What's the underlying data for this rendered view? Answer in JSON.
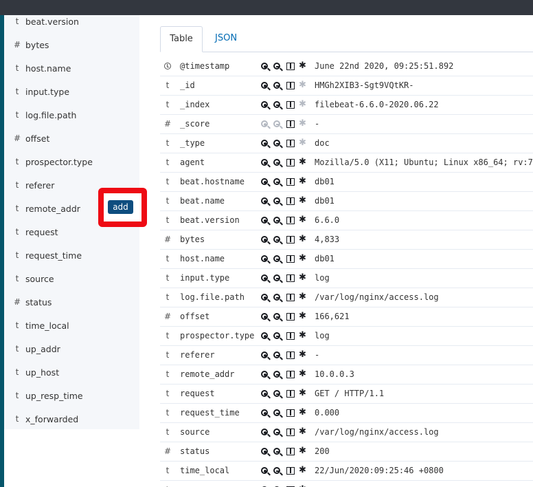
{
  "sidebar": {
    "fields": [
      {
        "type": "t",
        "name": "beat.version"
      },
      {
        "type": "#",
        "name": "bytes"
      },
      {
        "type": "t",
        "name": "host.name"
      },
      {
        "type": "t",
        "name": "input.type"
      },
      {
        "type": "t",
        "name": "log.file.path"
      },
      {
        "type": "#",
        "name": "offset"
      },
      {
        "type": "t",
        "name": "prospector.type"
      },
      {
        "type": "t",
        "name": "referer"
      },
      {
        "type": "t",
        "name": "remote_addr"
      },
      {
        "type": "t",
        "name": "request"
      },
      {
        "type": "t",
        "name": "request_time"
      },
      {
        "type": "t",
        "name": "source"
      },
      {
        "type": "#",
        "name": "status"
      },
      {
        "type": "t",
        "name": "time_local"
      },
      {
        "type": "t",
        "name": "up_addr"
      },
      {
        "type": "t",
        "name": "up_host"
      },
      {
        "type": "t",
        "name": "up_resp_time"
      },
      {
        "type": "t",
        "name": "x_forwarded"
      }
    ],
    "add_button_label": "add"
  },
  "tabs": {
    "table_label": "Table",
    "json_label": "JSON"
  },
  "icons": {
    "zoom_in": "zoom-in-icon",
    "zoom_out": "zoom-out-icon",
    "toggle_column": "toggle-column-icon",
    "filter_exists": "asterisk-icon",
    "timestamp": "clock-icon"
  },
  "colors": {
    "add_button": "#0e4d7f",
    "highlight_frame": "#ee0b14",
    "json_tab": "#006bb4",
    "sidebar_bg": "#f5f7fa",
    "top_bar": "#33373f",
    "left_edge": "#06566b"
  },
  "doc": {
    "rows": [
      {
        "type": "clock",
        "name": "@timestamp",
        "value": "June 22nd 2020, 09:25:51.892"
      },
      {
        "type": "t",
        "name": "_id",
        "value": "HMGh2XIB3-Sgt9VQtKR-",
        "exists_disabled": true
      },
      {
        "type": "t",
        "name": "_index",
        "value": "filebeat-6.6.0-2020.06.22",
        "exists_disabled": true
      },
      {
        "type": "#",
        "name": "_score",
        "value": " -",
        "filters_disabled": true,
        "exists_disabled": true
      },
      {
        "type": "t",
        "name": "_type",
        "value": "doc",
        "exists_disabled": true
      },
      {
        "type": "t",
        "name": "agent",
        "value": "Mozilla/5.0 (X11; Ubuntu; Linux x86_64; rv:7"
      },
      {
        "type": "t",
        "name": "beat.hostname",
        "value": "db01"
      },
      {
        "type": "t",
        "name": "beat.name",
        "value": "db01"
      },
      {
        "type": "t",
        "name": "beat.version",
        "value": "6.6.0"
      },
      {
        "type": "#",
        "name": "bytes",
        "value": "4,833"
      },
      {
        "type": "t",
        "name": "host.name",
        "value": "db01"
      },
      {
        "type": "t",
        "name": "input.type",
        "value": "log"
      },
      {
        "type": "t",
        "name": "log.file.path",
        "value": "/var/log/nginx/access.log"
      },
      {
        "type": "#",
        "name": "offset",
        "value": "166,621"
      },
      {
        "type": "t",
        "name": "prospector.type",
        "value": "log"
      },
      {
        "type": "t",
        "name": "referer",
        "value": "-"
      },
      {
        "type": "t",
        "name": "remote_addr",
        "value": "10.0.0.3"
      },
      {
        "type": "t",
        "name": "request",
        "value": "GET / HTTP/1.1"
      },
      {
        "type": "t",
        "name": "request_time",
        "value": "0.000"
      },
      {
        "type": "t",
        "name": "source",
        "value": "/var/log/nginx/access.log"
      },
      {
        "type": "#",
        "name": "status",
        "value": "200"
      },
      {
        "type": "t",
        "name": "time_local",
        "value": "22/Jun/2020:09:25:46 +0800"
      },
      {
        "type": "t",
        "name": "",
        "value": ""
      }
    ]
  }
}
